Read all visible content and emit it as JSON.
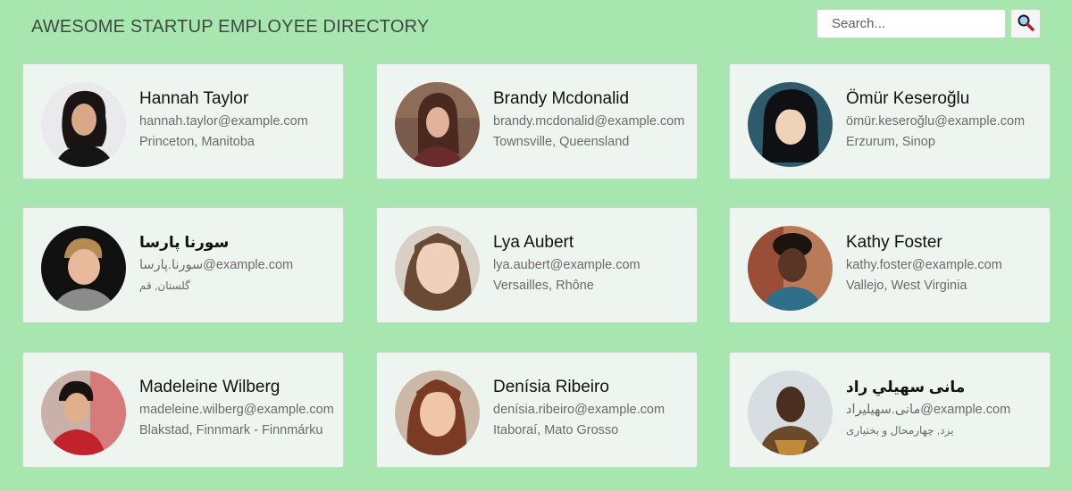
{
  "header": {
    "title": "AWESOME STARTUP EMPLOYEE DIRECTORY",
    "search_placeholder": "Search...",
    "search_icon": "magnifying-glass-icon"
  },
  "colors": {
    "page_background": "#a8e6af",
    "card_background": "#eef4ef",
    "card_border": "#c9d8cc",
    "title_text": "#3f4a42",
    "secondary_text": "#6b6b6b"
  },
  "employees": [
    {
      "name": "Hannah Taylor",
      "email": "hannah.taylor@example.com",
      "location": "Princeton, Manitoba"
    },
    {
      "name": "Brandy Mcdonalid",
      "email": "brandy.mcdonalid@example.com",
      "location": "Townsville, Queensland"
    },
    {
      "name": "Ömür Keseroğlu",
      "email": "ömür.keseroğlu@example.com",
      "location": "Erzurum, Sinop"
    },
    {
      "name": "سورنا پارسا",
      "email": "سورنا.پارسا@example.com",
      "location": "گلستان, قم"
    },
    {
      "name": "Lya Aubert",
      "email": "lya.aubert@example.com",
      "location": "Versailles, Rhône"
    },
    {
      "name": "Kathy Foster",
      "email": "kathy.foster@example.com",
      "location": "Vallejo, West Virginia"
    },
    {
      "name": "Madeleine Wilberg",
      "email": "madeleine.wilberg@example.com",
      "location": "Blakstad, Finnmark - Finnmárku"
    },
    {
      "name": "Denísia Ribeiro",
      "email": "denísia.ribeiro@example.com",
      "location": "Itaboraí, Mato Grosso"
    },
    {
      "name": "مانی سهيلي راد",
      "email": "مانی.سهيليراد@example.com",
      "location": "یزد, چهارمحال و بختیاری"
    }
  ]
}
